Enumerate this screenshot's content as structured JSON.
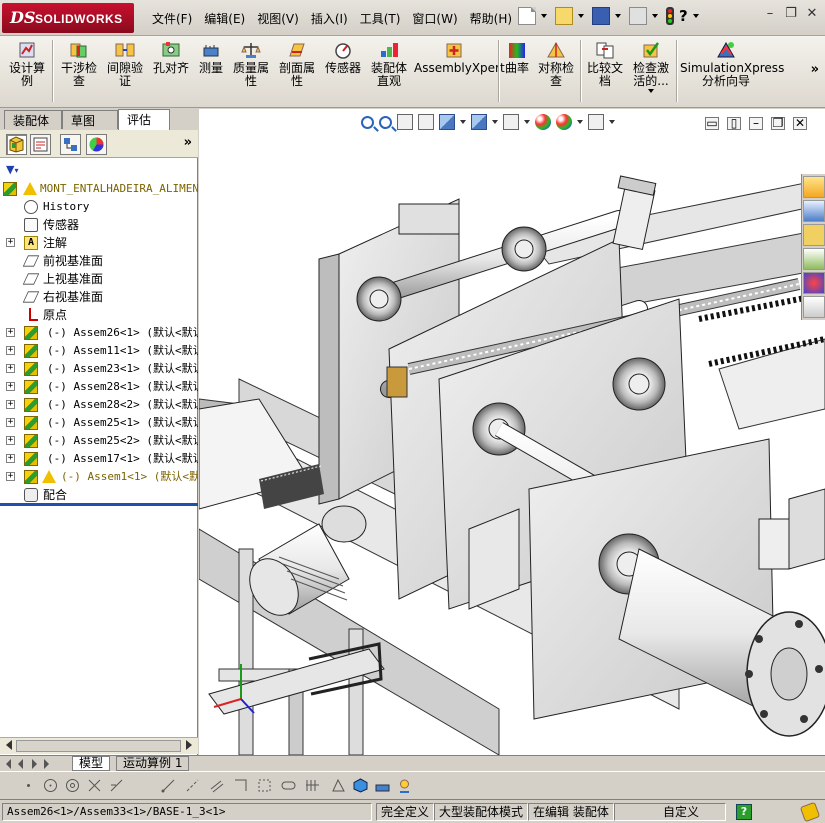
{
  "app": {
    "brand_ds": "DS",
    "brand_name": "SOLIDWORKS"
  },
  "menu": [
    "文件(F)",
    "编辑(E)",
    "视图(V)",
    "插入(I)",
    "工具(T)",
    "窗口(W)",
    "帮助(H)"
  ],
  "quick_help": "?",
  "commands": [
    {
      "label": "设计算\n例"
    },
    {
      "label": "干涉检\n查"
    },
    {
      "label": "间隙验\n证"
    },
    {
      "label": "孔对齐"
    },
    {
      "label": "测量"
    },
    {
      "label": "质量属\n性"
    },
    {
      "label": "剖面属\n性"
    },
    {
      "label": "传感器"
    },
    {
      "label": "装配体\n直观"
    },
    {
      "label": "AssemblyXpert"
    },
    {
      "label": "曲率"
    },
    {
      "label": "对称检\n查"
    },
    {
      "label": "比较文\n档"
    },
    {
      "label": "检查激\n活的..."
    },
    {
      "label": "SimulationXpress\n分析向导"
    }
  ],
  "more_chevron": "»",
  "tabs": [
    "装配体",
    "草图",
    "评估"
  ],
  "tabs_active": 2,
  "panel_more": "»",
  "tree": {
    "top": "MONT_ENTALHADEIRA_ALIMENTA",
    "items": [
      {
        "text": "History",
        "icon": "history-icon"
      },
      {
        "text": "传感器",
        "icon": "sensor-icon"
      },
      {
        "text": "注解",
        "icon": "annotation-icon",
        "expand": "+"
      },
      {
        "text": "前视基准面",
        "icon": "plane-icon"
      },
      {
        "text": "上视基准面",
        "icon": "plane-icon"
      },
      {
        "text": "右视基准面",
        "icon": "plane-icon"
      },
      {
        "text": "原点",
        "icon": "origin-icon"
      },
      {
        "text": "(-) Assem26<1> (默认<默认_",
        "icon": "assembly-icon",
        "expand": "+"
      },
      {
        "text": "(-) Assem11<1> (默认<默认_",
        "icon": "assembly-icon",
        "expand": "+"
      },
      {
        "text": "(-) Assem23<1> (默认<默认_",
        "icon": "assembly-icon",
        "expand": "+"
      },
      {
        "text": "(-) Assem28<1> (默认<默认_",
        "icon": "assembly-icon",
        "expand": "+"
      },
      {
        "text": "(-) Assem28<2> (默认<默认_",
        "icon": "assembly-icon",
        "expand": "+"
      },
      {
        "text": "(-) Assem25<1> (默认<默认_",
        "icon": "assembly-icon",
        "expand": "+"
      },
      {
        "text": "(-) Assem25<2> (默认<默认_",
        "icon": "assembly-icon",
        "expand": "+"
      },
      {
        "text": "(-) Assem17<1> (默认<默认_",
        "icon": "assembly-icon",
        "expand": "+"
      },
      {
        "text": "(-) Assem1<1> (默认<默认",
        "icon": "assembly-warning-icon",
        "expand": "+",
        "warning": true
      },
      {
        "text": "配合",
        "icon": "mates-icon"
      }
    ]
  },
  "bottom_tabs": [
    "模型",
    "运动算例 1"
  ],
  "status": {
    "path": "Assem26<1>/Assem33<1>/BASE-1_3<1>",
    "defined": "完全定义",
    "mode": "大型装配体模式",
    "editing": "在编辑 装配体",
    "units": "自定义"
  },
  "colors": {
    "brand": "#c8102e",
    "selection_bar": "#1f4fb0",
    "background": "#d4d0c8"
  }
}
